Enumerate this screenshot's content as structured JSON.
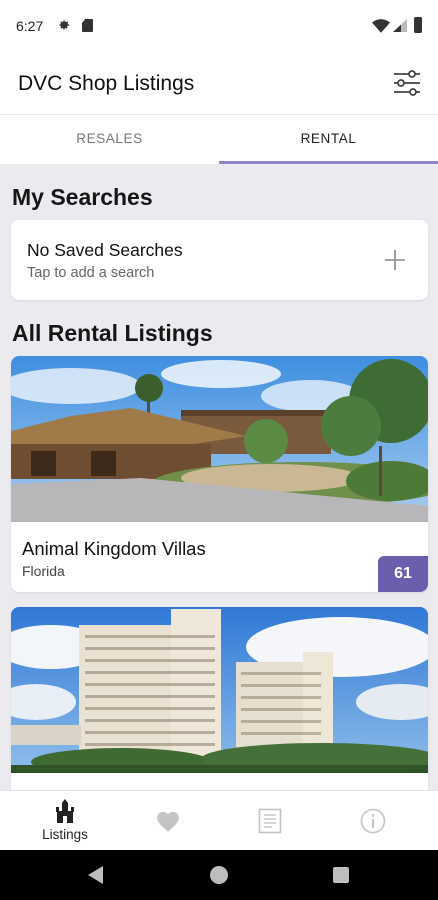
{
  "status_bar": {
    "time": "6:27",
    "icons": [
      "gear-icon",
      "sim-card-icon",
      "wifi-icon",
      "cell-signal-icon",
      "battery-icon"
    ]
  },
  "app_bar": {
    "title": "DVC Shop Listings",
    "filter_icon": "sliders-icon"
  },
  "tabs": [
    {
      "label": "RESALES",
      "selected": false
    },
    {
      "label": "RENTAL",
      "selected": true
    }
  ],
  "my_searches": {
    "title": "My Searches",
    "empty_title": "No Saved Searches",
    "empty_subtitle": "Tap to add a search",
    "add_icon": "plus-icon"
  },
  "all_listings": {
    "title": "All Rental Listings",
    "items": [
      {
        "name": "Animal Kingdom Villas",
        "location": "Florida",
        "count": "61",
        "image": "resort-lodge-photo"
      },
      {
        "name": "",
        "location": "",
        "count": "",
        "image": "tower-hotel-photo"
      }
    ]
  },
  "bottom_nav": [
    {
      "label": "Listings",
      "icon": "castle-icon",
      "selected": true
    },
    {
      "label": "",
      "icon": "heart-icon",
      "selected": false
    },
    {
      "label": "",
      "icon": "document-icon",
      "selected": false
    },
    {
      "label": "",
      "icon": "info-icon",
      "selected": false
    }
  ],
  "colors": {
    "accent": "#6b5fad",
    "tab_indicator": "#8f86c6",
    "background": "#ebeaef"
  }
}
